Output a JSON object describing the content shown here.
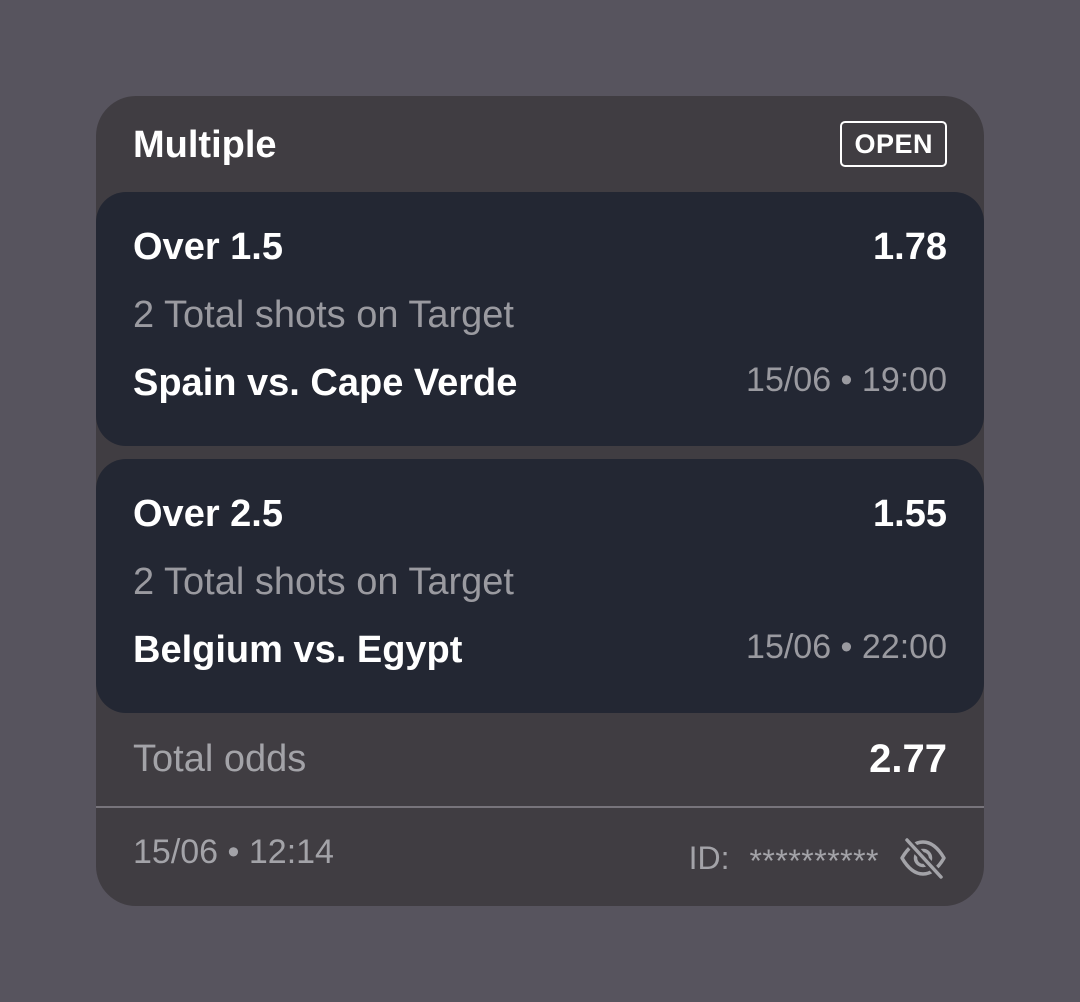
{
  "bet": {
    "type_label": "Multiple",
    "status": "OPEN",
    "legs": [
      {
        "selection": "Over 1.5",
        "odds": "1.78",
        "market": "2 Total shots on Target",
        "match": "Spain vs. Cape Verde",
        "datetime": "15/06 • 19:00"
      },
      {
        "selection": "Over 2.5",
        "odds": "1.55",
        "market": "2 Total shots on Target",
        "match": "Belgium vs. Egypt",
        "datetime": "15/06 • 22:00"
      }
    ],
    "total_odds_label": "Total odds",
    "total_odds": "2.77",
    "placed_datetime": "15/06 • 12:14",
    "id_label": "ID:",
    "id_value": "**********",
    "id_visibility_icon": "eye-off-icon"
  },
  "colors": {
    "page_background": "#57545e",
    "card_background": "#403d42",
    "leg_background": "#232733",
    "primary_text": "#ffffff",
    "secondary_text": "#9a9aa0"
  }
}
